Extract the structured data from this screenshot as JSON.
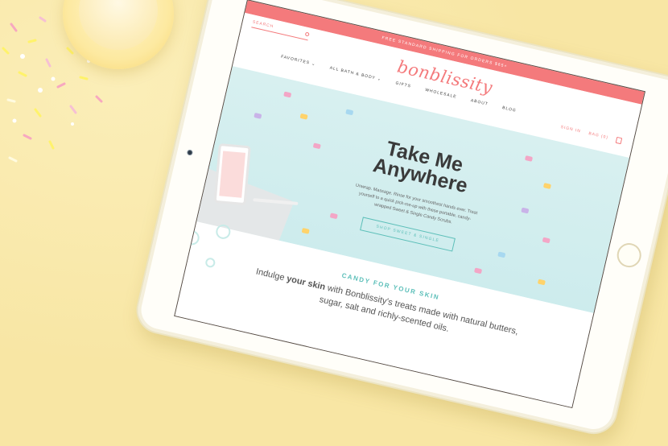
{
  "scene": {
    "background_color": "#f8e6a4",
    "accent_coral": "#f47a7c",
    "accent_teal": "#5cbfb9"
  },
  "site": {
    "promo_text": "FREE STANDARD SHIPPING FOR ORDERS $65+",
    "search_placeholder": "SEARCH",
    "logo": "bonblissity",
    "sign_in": "SIGN IN",
    "bag": "BAG (0)",
    "nav": [
      "FAVORITES ⌄",
      "ALL BATH & BODY ⌄",
      "GIFTS",
      "WHOLESALE",
      "ABOUT",
      "BLOG"
    ]
  },
  "hero": {
    "title_line1": "Take Me",
    "title_line2": "Anywhere",
    "text": "Unwrap. Massage. Rinse for your smoothest hands ever. Treat yourself to a quick pick-me-up with these portable, candy-wrapped Sweet & Single Candy Scrubs.",
    "button": "SHOP SWEET & SINGLE"
  },
  "section": {
    "title": "CANDY FOR YOUR SKIN",
    "body_prefix": "Indulge ",
    "body_bold": "your skin",
    "body_suffix": " with Bonblissity's treats made with natural butters, sugar, salt and richly-scented oils."
  }
}
